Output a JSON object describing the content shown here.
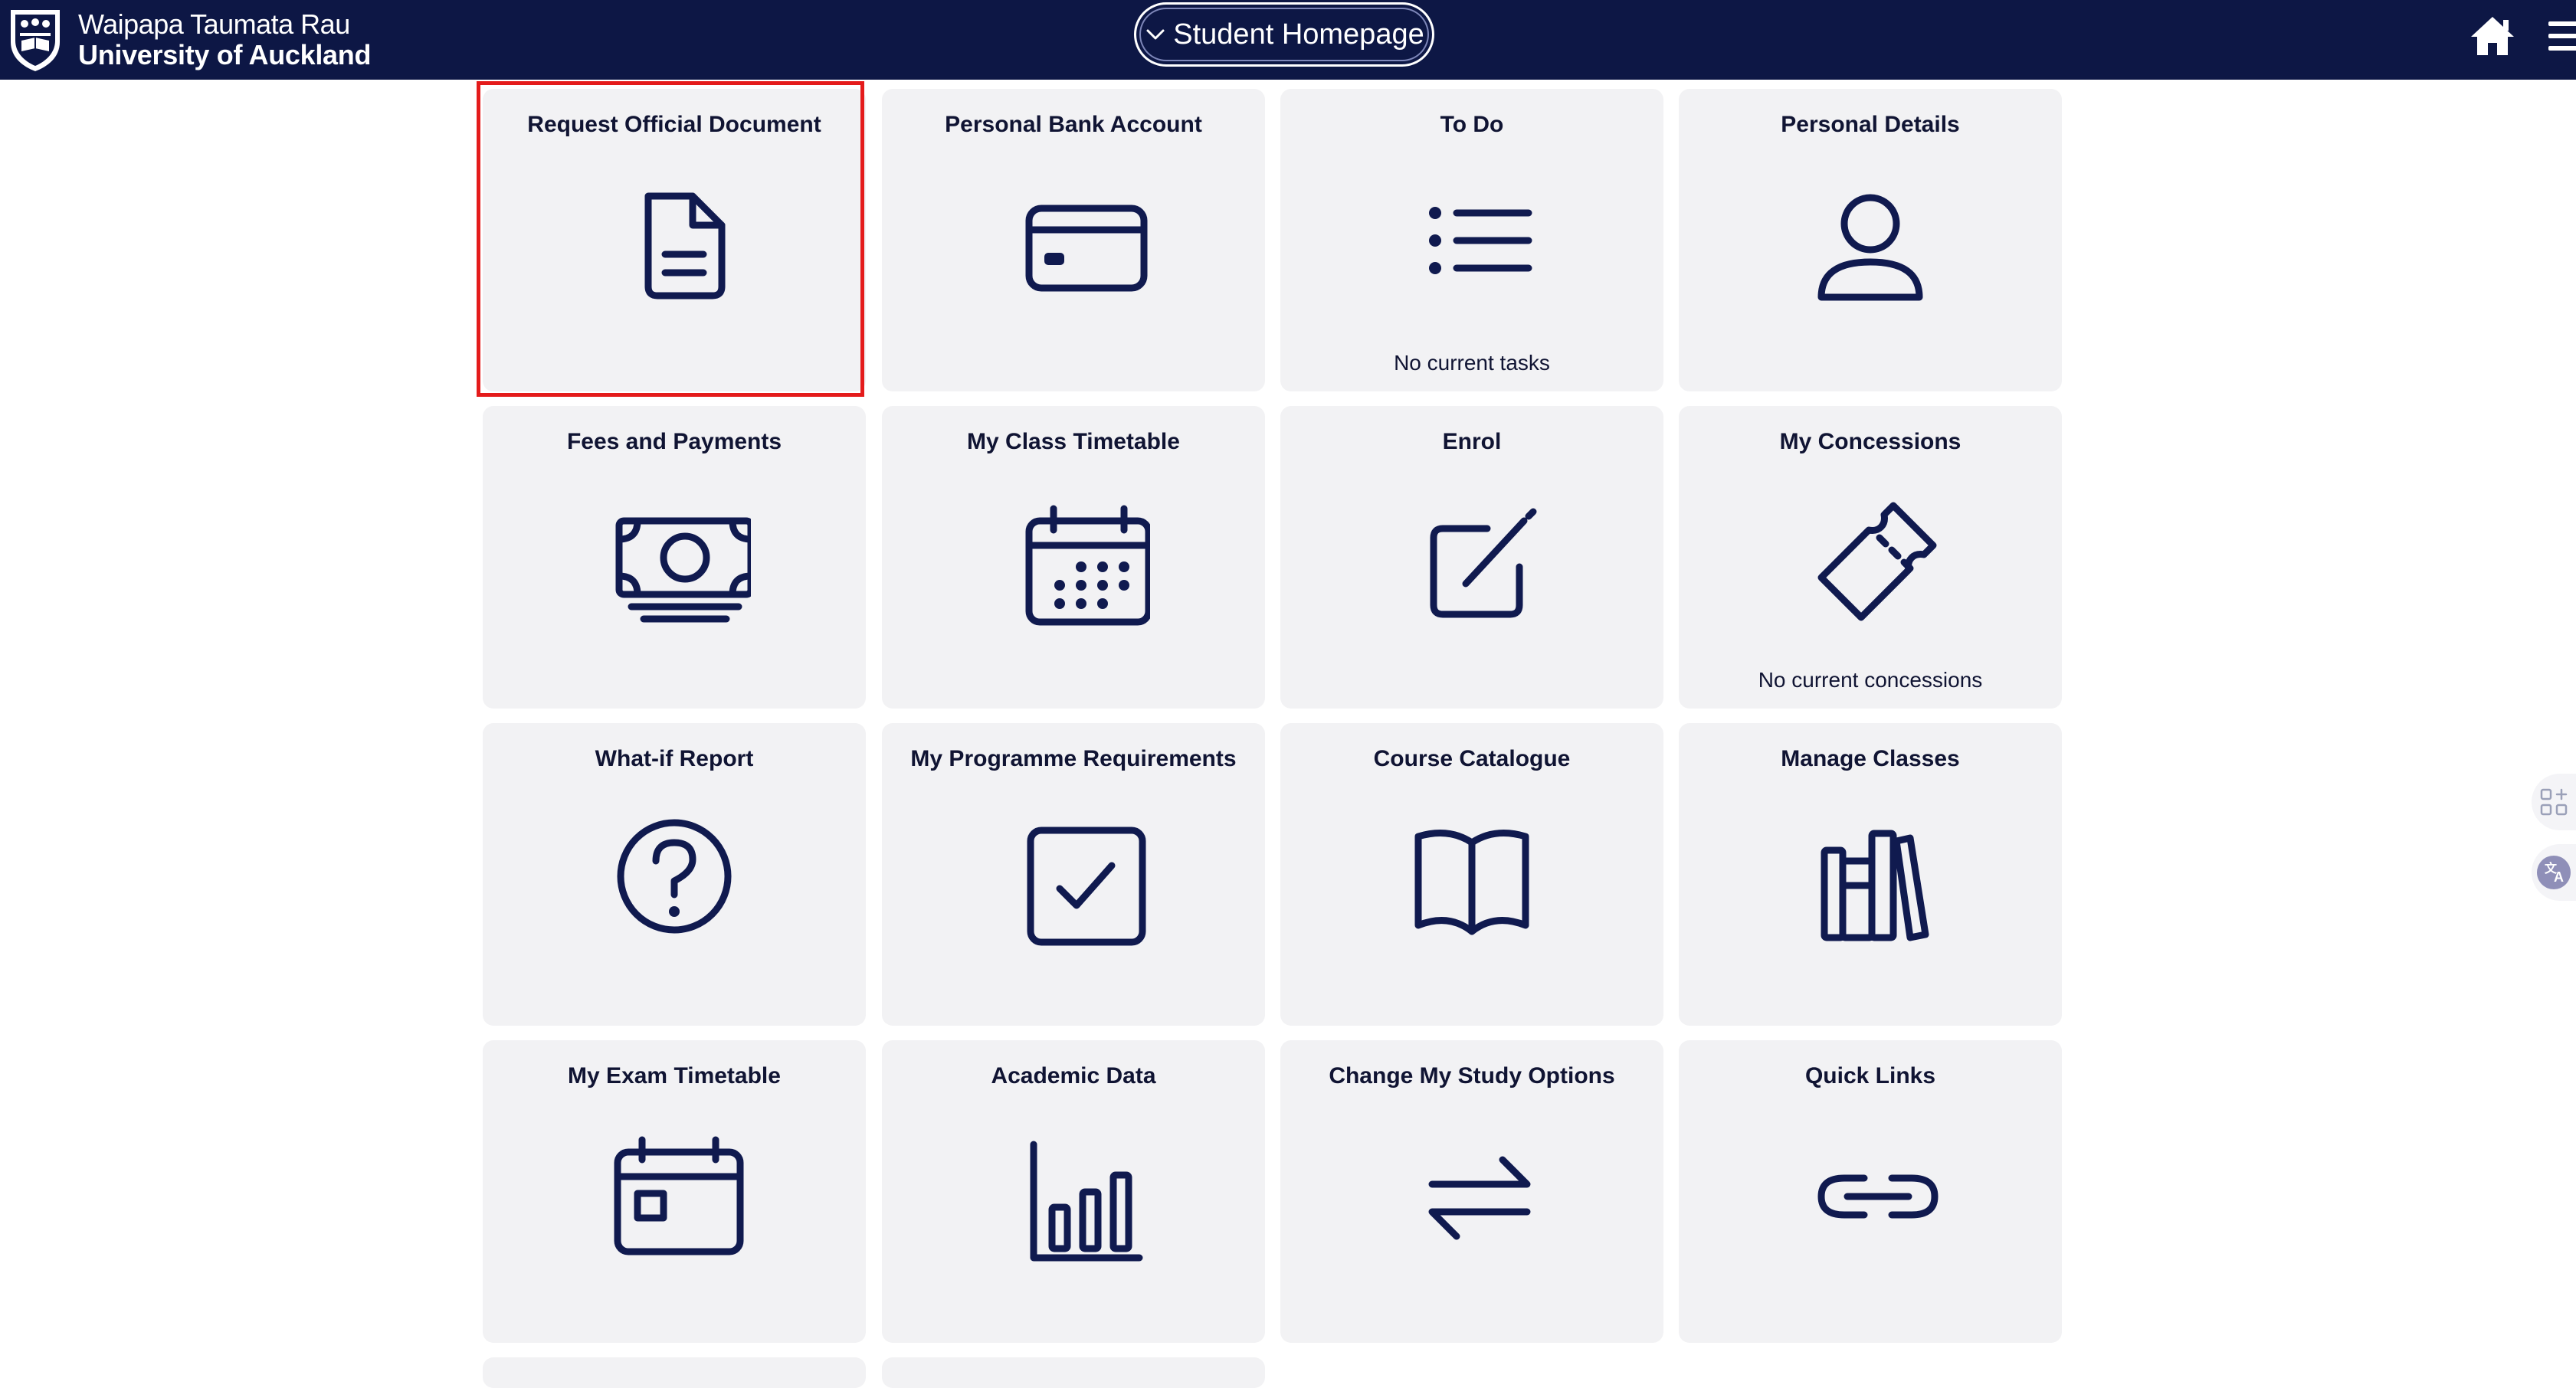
{
  "header": {
    "logo_line1": "Waipapa Taumata Rau",
    "logo_line2": "University of Auckland",
    "homepage_selector": "Student Homepage",
    "brand_color": "#0d1745"
  },
  "tiles": [
    {
      "title": "Request Official Document",
      "icon": "document-icon",
      "status": ""
    },
    {
      "title": "Personal Bank Account",
      "icon": "credit-card-icon",
      "status": ""
    },
    {
      "title": "To Do",
      "icon": "list-icon",
      "status": "No current tasks"
    },
    {
      "title": "Personal Details",
      "icon": "user-icon",
      "status": ""
    },
    {
      "title": "Fees and Payments",
      "icon": "banknote-icon",
      "status": ""
    },
    {
      "title": "My Class Timetable",
      "icon": "calendar-icon",
      "status": ""
    },
    {
      "title": "Enrol",
      "icon": "edit-icon",
      "status": ""
    },
    {
      "title": "My Concessions",
      "icon": "ticket-icon",
      "status": "No current concessions"
    },
    {
      "title": "What-if Report",
      "icon": "question-icon",
      "status": ""
    },
    {
      "title": "My Programme Requirements",
      "icon": "checkbox-icon",
      "status": ""
    },
    {
      "title": "Course Catalogue",
      "icon": "book-open-icon",
      "status": ""
    },
    {
      "title": "Manage Classes",
      "icon": "books-icon",
      "status": ""
    },
    {
      "title": "My Exam Timetable",
      "icon": "calendar-event-icon",
      "status": ""
    },
    {
      "title": "Academic Data",
      "icon": "bar-chart-icon",
      "status": ""
    },
    {
      "title": "Change My Study Options",
      "icon": "swap-icon",
      "status": ""
    },
    {
      "title": "Quick Links",
      "icon": "link-icon",
      "status": ""
    }
  ],
  "selected_tile": "Request Official Document",
  "side_widgets": [
    "apps-icon",
    "translate-icon"
  ]
}
